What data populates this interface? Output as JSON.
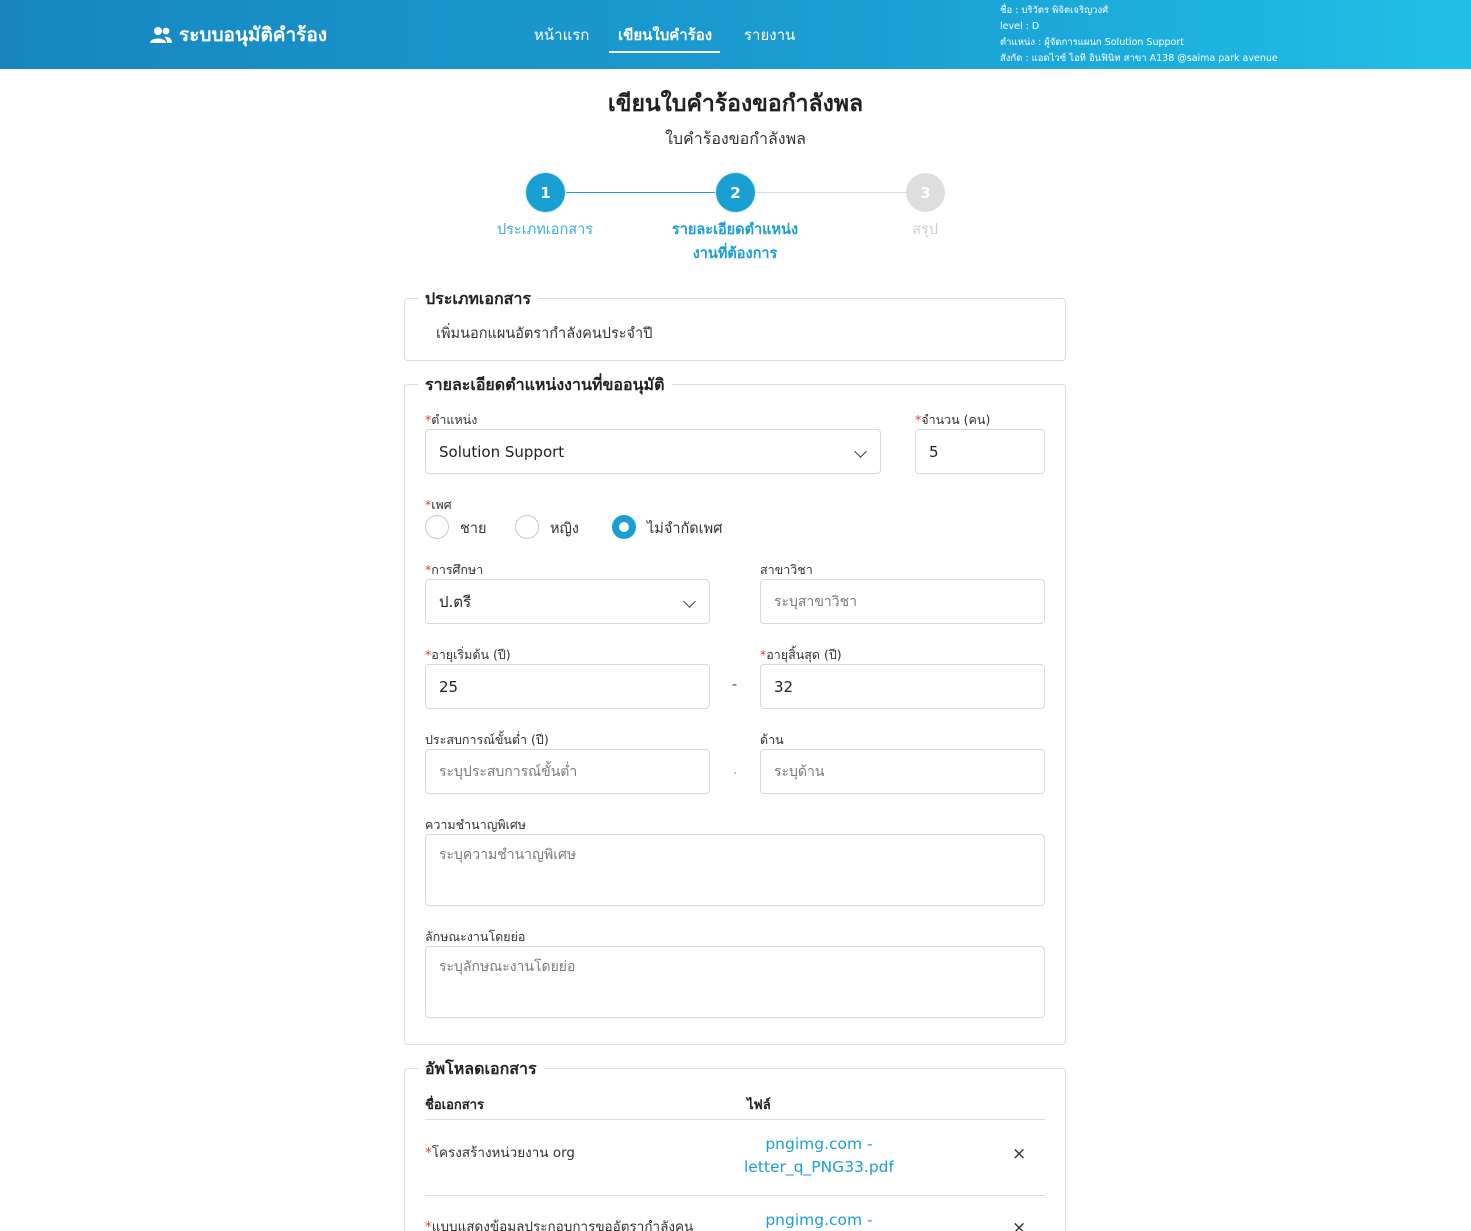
{
  "header": {
    "brand": "ระบบอนุมัติคำร้อง",
    "nav": [
      "หน้าแรก",
      "เขียนใบคำร้อง",
      "รายงาน"
    ],
    "user_lines": [
      "ชื่อ : บริวัตร พิจิตเจริญวงศ์",
      "level : D",
      "ตำแหน่ง : ผู้จัดการแผนก Solution Support",
      "สังกัด : แอดไวซ์ ไอที อินฟินิท สาขา A138 @saima park avenue"
    ]
  },
  "page": {
    "title": "เขียนใบคำร้องขอกำลังพล",
    "subtitle": "ใบคำร้องขอกำลังพล"
  },
  "steps": [
    {
      "number": "1",
      "label": "ประเภทเอกสาร",
      "state": "done"
    },
    {
      "number": "2",
      "label_line1": "รายละเอียดตำแหน่ง",
      "label_line2": "งานที่ต้องการ",
      "state": "current"
    },
    {
      "number": "3",
      "label": "สรุป",
      "state": "todo"
    }
  ],
  "doc_type": {
    "legend": "ประเภทเอกสาร",
    "value": "เพิ่มนอกแผนอัตรากำลังคนประจำปี"
  },
  "details": {
    "legend": "รายละเอียดตำแหน่งงานที่ขออนุมัติ",
    "position": {
      "label": "ตำแหน่ง",
      "value": "Solution Support"
    },
    "quantity": {
      "label": "จำนวน (คน)",
      "value": "5"
    },
    "gender": {
      "label": "เพศ",
      "options": [
        "ชาย",
        "หญิง",
        "ไม่จำกัดเพศ"
      ],
      "selected": "ไม่จำกัดเพศ"
    },
    "education": {
      "label": "การศึกษา",
      "value": "ป.ตรี"
    },
    "major": {
      "label": "สาขาวิชา",
      "placeholder": "ระบุสาขาวิชา"
    },
    "age_min": {
      "label": "อายุเริ่มต้น (ปี)",
      "value": "25"
    },
    "age_max": {
      "label": "อายุสิ้นสุด (ปี)",
      "value": "32"
    },
    "age_separator": "-",
    "experience": {
      "label": "ประสบการณ์ขั้นต่ำ (ปี)",
      "placeholder": "ระบุประสบการณ์ขั้นต่ำ"
    },
    "exp_separator": ".",
    "area": {
      "label": "ด้าน",
      "placeholder": "ระบุด้าน"
    },
    "expertise": {
      "label": "ความชำนาญพิเศษ",
      "placeholder": "ระบุความชำนาญพิเศษ"
    },
    "job_summary": {
      "label": "ลักษณะงานโดยย่อ",
      "placeholder": "ระบุลักษณะงานโดยย่อ"
    }
  },
  "upload": {
    "legend": "อัพโหลดเอกสาร",
    "col_name": "ชื่อเอกสาร",
    "col_file": "ไฟล์",
    "rows": [
      {
        "name": "โครงสร้างหน่วยงาน org",
        "file_line1": "pngimg.com -",
        "file_line2": "letter_q_PNG33.pdf",
        "remove": "×"
      },
      {
        "name": "แบบแสดงข้อมูลประกอบการขออัตรากำลังคน",
        "file_line1": "pngimg.com -",
        "remove": "×"
      }
    ]
  },
  "required_mark": "*",
  "colors": {
    "accent": "#1a9fd3",
    "required": "#e23b3b"
  },
  "icons": {
    "brand": "users-icon",
    "select": "chevron-down-icon"
  }
}
